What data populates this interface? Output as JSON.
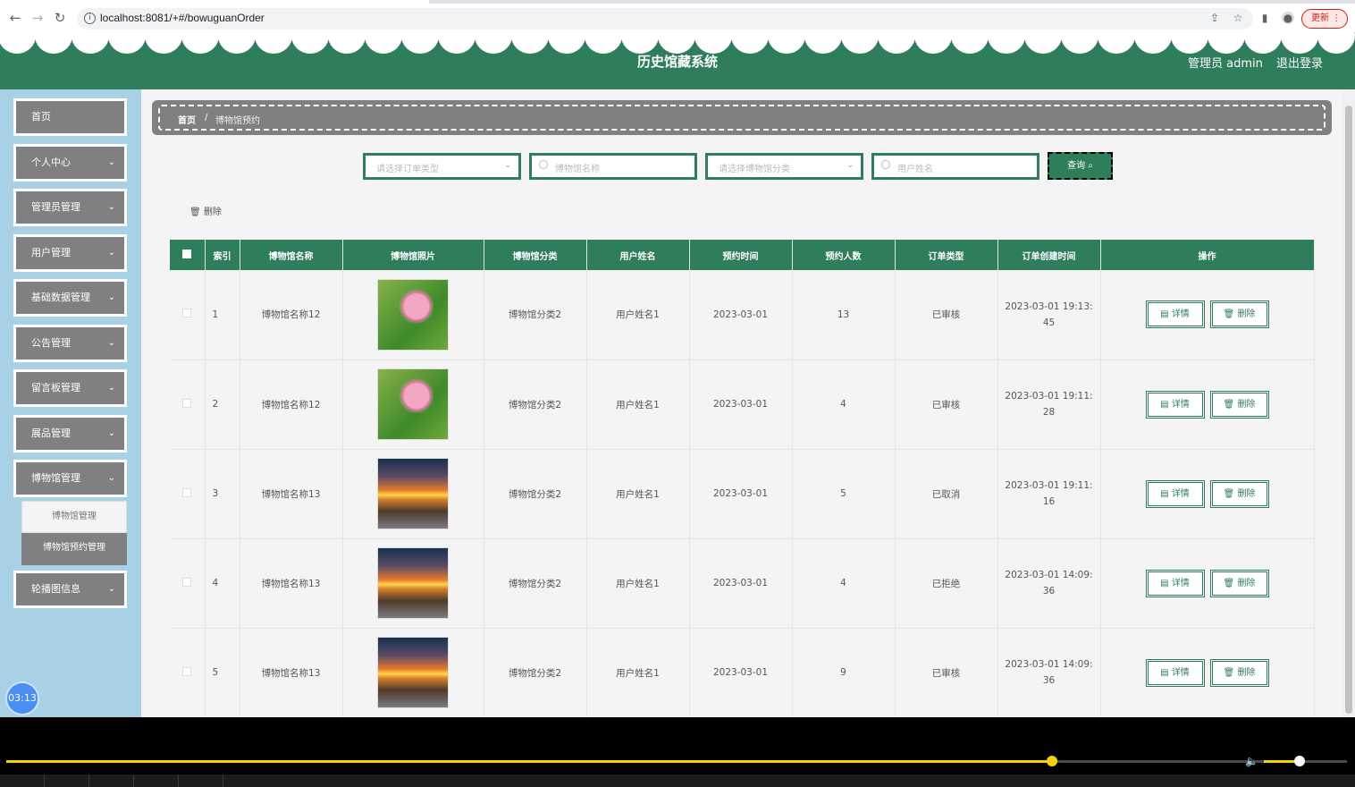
{
  "browser": {
    "url": "localhost:8081/+#/bowuguanOrder",
    "update_label": "更新"
  },
  "header": {
    "title": "历史馆藏系统",
    "user": "管理员 admin",
    "logout": "退出登录"
  },
  "sidebar": {
    "items": [
      {
        "label": "首页",
        "has_arrow": false
      },
      {
        "label": "个人中心",
        "has_arrow": true
      },
      {
        "label": "管理员管理",
        "has_arrow": true
      },
      {
        "label": "用户管理",
        "has_arrow": true
      },
      {
        "label": "基础数据管理",
        "has_arrow": true
      },
      {
        "label": "公告管理",
        "has_arrow": true
      },
      {
        "label": "留言板管理",
        "has_arrow": true
      },
      {
        "label": "展品管理",
        "has_arrow": true
      },
      {
        "label": "博物馆管理",
        "has_arrow": true
      },
      {
        "label": "轮播图信息",
        "has_arrow": true
      }
    ],
    "submenu": [
      "博物馆管理",
      "博物馆预约管理"
    ],
    "clock": "03:13"
  },
  "breadcrumb": {
    "home": "首页",
    "separator": "/",
    "current": "博物馆预约"
  },
  "filters": {
    "order_type_placeholder": "请选择订单类型",
    "museum_name_placeholder": "博物馆名称",
    "museum_category_placeholder": "请选择博物馆分类",
    "user_name_placeholder": "用户姓名",
    "search_label": "查询"
  },
  "toolbar": {
    "delete_label": "删除"
  },
  "table": {
    "columns": [
      "索引",
      "博物馆名称",
      "博物馆照片",
      "博物馆分类",
      "用户姓名",
      "预约时间",
      "预约人数",
      "订单类型",
      "订单创建时间",
      "操作"
    ],
    "rows": [
      {
        "index": "1",
        "name": "博物馆名称12",
        "photo": "lotus",
        "category": "博物馆分类2",
        "user": "用户姓名1",
        "date": "2023-03-01",
        "count": "13",
        "status": "已审核",
        "created_a": "2023-03-01 19:13:",
        "created_b": "45"
      },
      {
        "index": "2",
        "name": "博物馆名称12",
        "photo": "lotus",
        "category": "博物馆分类2",
        "user": "用户姓名1",
        "date": "2023-03-01",
        "count": "4",
        "status": "已审核",
        "created_a": "2023-03-01 19:11:",
        "created_b": "28"
      },
      {
        "index": "3",
        "name": "博物馆名称13",
        "photo": "sunset",
        "category": "博物馆分类2",
        "user": "用户姓名1",
        "date": "2023-03-01",
        "count": "5",
        "status": "已取消",
        "created_a": "2023-03-01 19:11:",
        "created_b": "16"
      },
      {
        "index": "4",
        "name": "博物馆名称13",
        "photo": "sunset",
        "category": "博物馆分类2",
        "user": "用户姓名1",
        "date": "2023-03-01",
        "count": "4",
        "status": "已拒绝",
        "created_a": "2023-03-01 14:09:",
        "created_b": "36"
      },
      {
        "index": "5",
        "name": "博物馆名称13",
        "photo": "sunset",
        "category": "博物馆分类2",
        "user": "用户姓名1",
        "date": "2023-03-01",
        "count": "9",
        "status": "已审核",
        "created_a": "2023-03-01 14:09:",
        "created_b": "36"
      }
    ],
    "action_detail": "详情",
    "action_delete": "删除"
  },
  "player": {
    "progress": 0.78,
    "volume": 0.45
  },
  "colors": {
    "primary": "#2e7d5b",
    "menu_bg": "#808080",
    "sidebar_bg": "#a8d1e6",
    "accent": "#f5d200"
  }
}
